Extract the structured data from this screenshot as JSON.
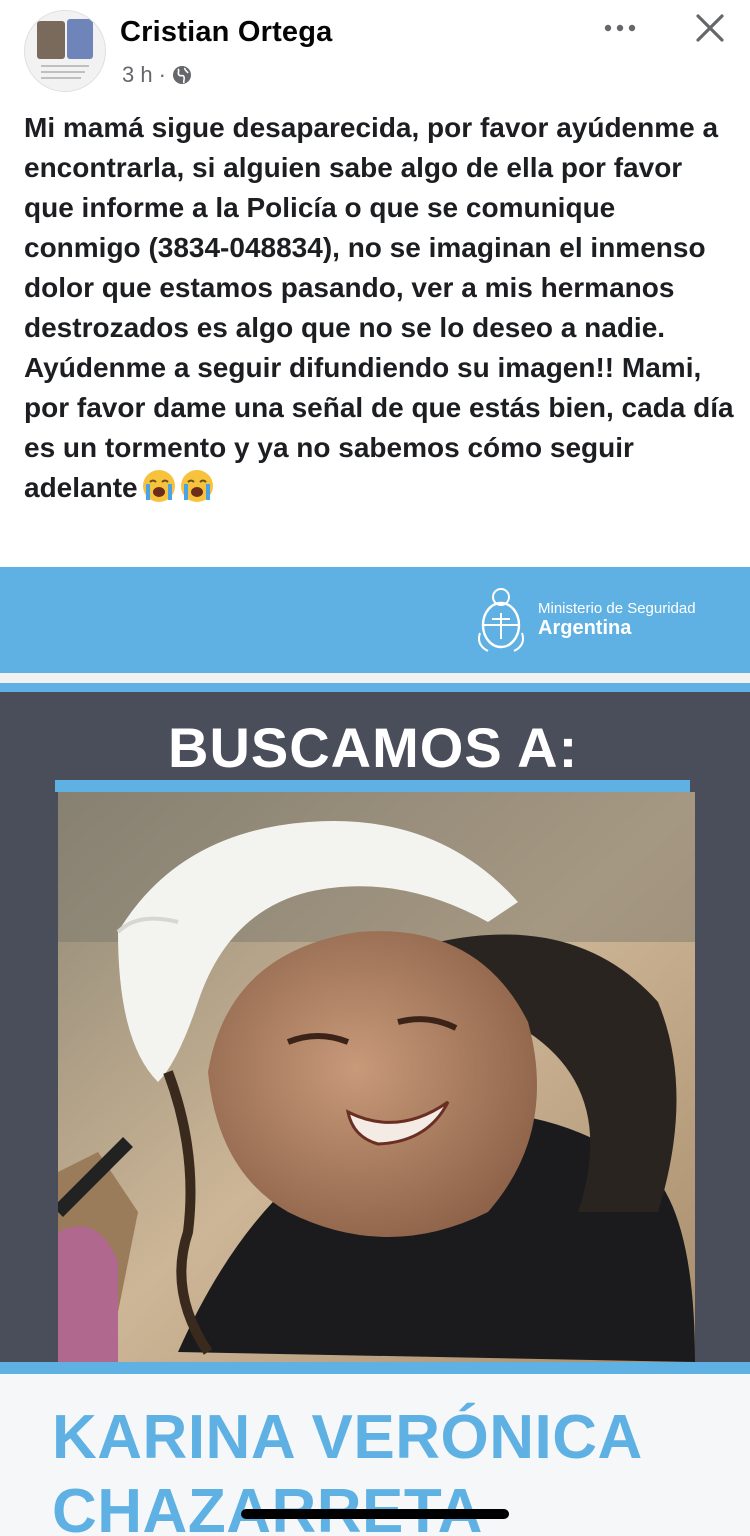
{
  "post": {
    "author": "Cristian Ortega",
    "time": "3 h",
    "separator": "·",
    "privacy_icon": "globe-icon",
    "text": "Mi mamá sigue desaparecida, por favor ayúdenme a encontrarla, si alguien sabe algo de ella por favor que informe a la Policía o que se comunique conmigo (3834-048834), no se imaginan el inmenso dolor que estamos pasando, ver a mis hermanos destrozados es algo que no se lo deseo a nadie. Ayúdenme a seguir difundiendo su imagen!! Mami, por favor dame una señal de que estás bien, cada día es un tormento y ya no sabemos cómo seguir adelante",
    "emojis": [
      "loudly-crying-face-icon",
      "loudly-crying-face-icon"
    ]
  },
  "poster": {
    "ministry_line1": "Ministerio de Seguridad",
    "ministry_line2": "Argentina",
    "headline": "BUSCAMOS A:",
    "person_name": "KARINA VERÓNICA CHAZARRETA",
    "colors": {
      "accent": "#5fb1e3",
      "dark": "#4a4e5a"
    }
  },
  "actions": {
    "more_icon": "more-options-icon",
    "close_icon": "close-icon"
  }
}
